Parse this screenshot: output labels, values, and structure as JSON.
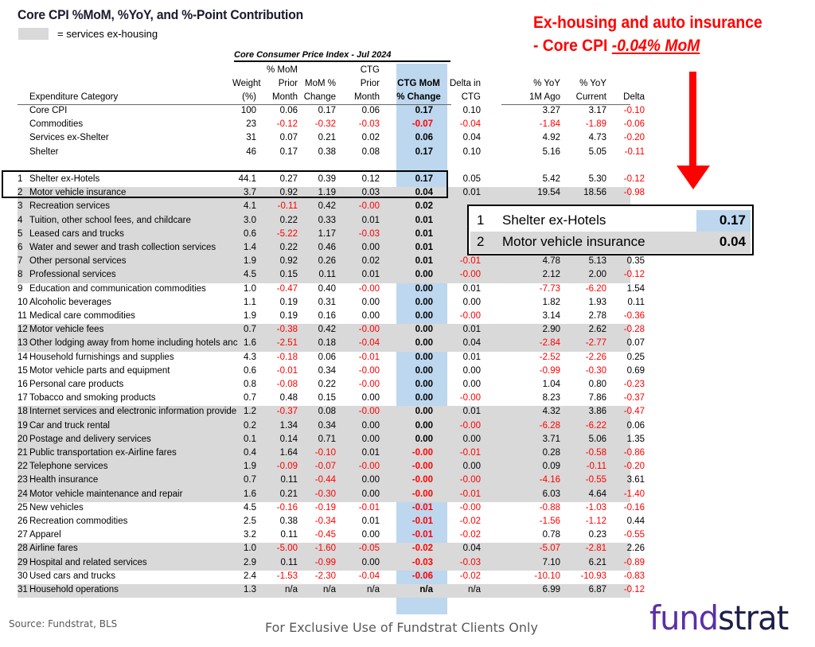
{
  "title": "Core CPI %MoM, %YoY, and %-Point Contribution",
  "legend": {
    "label": "= services ex-housing",
    "swatch_color": "#d9d9d9"
  },
  "callout": {
    "line1": "Ex-housing and auto insurance",
    "line2_prefix": "- Core CPI ",
    "line2_value": "-0.04% MoM",
    "color": "#ff0000"
  },
  "table": {
    "caption": "Core Consumer Price Index - Jul 2024",
    "headers": {
      "category": "Expenditure Category",
      "weight": [
        "Weight",
        "(%)"
      ],
      "prior": [
        "% MoM",
        "Prior",
        "Month"
      ],
      "mom": [
        "MoM %",
        "Change"
      ],
      "ctg_prior": [
        "CTG",
        "Prior",
        "Month"
      ],
      "ctg": [
        "CTG MoM",
        "% Change"
      ],
      "delta_ctg": [
        "Delta in",
        "CTG"
      ],
      "yoy_1m": [
        "% YoY",
        "1M Ago"
      ],
      "yoy_cur": [
        "% YoY",
        "Current"
      ],
      "delta": [
        "Delta"
      ]
    },
    "summary_rows": [
      {
        "cat": "Core CPI",
        "w": "100",
        "pm": "0.06",
        "mom": "0.17",
        "cp": "0.06",
        "ctg": "0.17",
        "dc": "0.10",
        "y1": "3.27",
        "yc": "3.17",
        "d": "-0.10"
      },
      {
        "cat": "Commodities",
        "w": "23",
        "pm": "-0.12",
        "mom": "-0.32",
        "cp": "-0.03",
        "ctg": "-0.07",
        "dc": "-0.04",
        "y1": "-1.84",
        "yc": "-1.89",
        "d": "-0.06"
      },
      {
        "cat": "Services ex-Shelter",
        "w": "31",
        "pm": "0.07",
        "mom": "0.21",
        "cp": "0.02",
        "ctg": "0.06",
        "dc": "0.04",
        "y1": "4.92",
        "yc": "4.73",
        "d": "-0.20"
      },
      {
        "cat": "Shelter",
        "w": "46",
        "pm": "0.17",
        "mom": "0.38",
        "cp": "0.08",
        "ctg": "0.17",
        "dc": "0.10",
        "y1": "5.16",
        "yc": "5.05",
        "d": "-0.11"
      }
    ],
    "rows": [
      {
        "n": "1",
        "cat": "Shelter ex-Hotels",
        "g": false,
        "w": "44.1",
        "pm": "0.27",
        "mom": "0.39",
        "cp": "0.12",
        "ctg": "0.17",
        "dc": "0.05",
        "y1": "5.42",
        "yc": "5.30",
        "d": "-0.12"
      },
      {
        "n": "2",
        "cat": "Motor vehicle insurance",
        "g": true,
        "w": "3.7",
        "pm": "0.92",
        "mom": "1.19",
        "cp": "0.03",
        "ctg": "0.04",
        "dc": "0.01",
        "y1": "19.54",
        "yc": "18.56",
        "d": "-0.98"
      },
      {
        "n": "3",
        "cat": "Recreation services",
        "g": true,
        "w": "4.1",
        "pm": "-0.11",
        "mom": "0.42",
        "cp": "-0.00",
        "ctg": "0.02",
        "dc": "",
        "y1": "",
        "yc": "",
        "d": ""
      },
      {
        "n": "4",
        "cat": "Tuition, other school fees, and childcare",
        "g": true,
        "w": "3.0",
        "pm": "0.22",
        "mom": "0.33",
        "cp": "0.01",
        "ctg": "0.01",
        "dc": "",
        "y1": "",
        "yc": "",
        "d": ""
      },
      {
        "n": "5",
        "cat": "Leased cars and trucks",
        "g": true,
        "w": "0.6",
        "pm": "-5.22",
        "mom": "1.17",
        "cp": "-0.03",
        "ctg": "0.01",
        "dc": "",
        "y1": "",
        "yc": "",
        "d": ""
      },
      {
        "n": "6",
        "cat": "Water and sewer and trash collection services",
        "g": true,
        "w": "1.4",
        "pm": "0.22",
        "mom": "0.46",
        "cp": "0.00",
        "ctg": "0.01",
        "dc": "",
        "y1": "",
        "yc": "",
        "d": ""
      },
      {
        "n": "7",
        "cat": "Other personal services",
        "g": true,
        "w": "1.9",
        "pm": "0.92",
        "mom": "0.26",
        "cp": "0.02",
        "ctg": "0.01",
        "dc": "-0.01",
        "y1": "4.78",
        "yc": "5.13",
        "d": "0.35"
      },
      {
        "n": "8",
        "cat": "Professional services",
        "g": true,
        "w": "4.5",
        "pm": "0.15",
        "mom": "0.11",
        "cp": "0.01",
        "ctg": "0.00",
        "dc": "-0.00",
        "y1": "2.12",
        "yc": "2.00",
        "d": "-0.12"
      },
      {
        "n": "9",
        "cat": "Education and communication commodities",
        "g": false,
        "w": "1.0",
        "pm": "-0.47",
        "mom": "0.40",
        "cp": "-0.00",
        "ctg": "0.00",
        "dc": "0.01",
        "y1": "-7.73",
        "yc": "-6.20",
        "d": "1.54"
      },
      {
        "n": "10",
        "cat": "Alcoholic beverages",
        "g": false,
        "w": "1.1",
        "pm": "0.19",
        "mom": "0.31",
        "cp": "0.00",
        "ctg": "0.00",
        "dc": "0.00",
        "y1": "1.82",
        "yc": "1.93",
        "d": "0.11"
      },
      {
        "n": "11",
        "cat": "Medical care commodities",
        "g": false,
        "w": "1.9",
        "pm": "0.19",
        "mom": "0.16",
        "cp": "0.00",
        "ctg": "0.00",
        "dc": "-0.00",
        "y1": "3.14",
        "yc": "2.78",
        "d": "-0.36"
      },
      {
        "n": "12",
        "cat": "Motor vehicle fees",
        "g": true,
        "w": "0.7",
        "pm": "-0.38",
        "mom": "0.42",
        "cp": "-0.00",
        "ctg": "0.00",
        "dc": "0.01",
        "y1": "2.90",
        "yc": "2.62",
        "d": "-0.28"
      },
      {
        "n": "13",
        "cat": "Other lodging away from home including hotels anc",
        "g": true,
        "w": "1.6",
        "pm": "-2.51",
        "mom": "0.18",
        "cp": "-0.04",
        "ctg": "0.00",
        "dc": "0.04",
        "y1": "-2.84",
        "yc": "-2.77",
        "d": "0.07"
      },
      {
        "n": "14",
        "cat": "Household furnishings and supplies",
        "g": false,
        "w": "4.3",
        "pm": "-0.18",
        "mom": "0.06",
        "cp": "-0.01",
        "ctg": "0.00",
        "dc": "0.01",
        "y1": "-2.52",
        "yc": "-2.26",
        "d": "0.25"
      },
      {
        "n": "15",
        "cat": "Motor vehicle parts and equipment",
        "g": false,
        "w": "0.6",
        "pm": "-0.01",
        "mom": "0.34",
        "cp": "-0.00",
        "ctg": "0.00",
        "dc": "0.00",
        "y1": "-0.99",
        "yc": "-0.30",
        "d": "0.69"
      },
      {
        "n": "16",
        "cat": "Personal care products",
        "g": false,
        "w": "0.8",
        "pm": "-0.08",
        "mom": "0.22",
        "cp": "-0.00",
        "ctg": "0.00",
        "dc": "0.00",
        "y1": "1.04",
        "yc": "0.80",
        "d": "-0.23"
      },
      {
        "n": "17",
        "cat": "Tobacco and smoking products",
        "g": false,
        "w": "0.7",
        "pm": "0.48",
        "mom": "0.15",
        "cp": "0.00",
        "ctg": "0.00",
        "dc": "-0.00",
        "y1": "8.23",
        "yc": "7.86",
        "d": "-0.37"
      },
      {
        "n": "18",
        "cat": "Internet services and electronic information provide",
        "g": true,
        "w": "1.2",
        "pm": "-0.37",
        "mom": "0.08",
        "cp": "-0.00",
        "ctg": "0.00",
        "dc": "0.01",
        "y1": "4.32",
        "yc": "3.86",
        "d": "-0.47"
      },
      {
        "n": "19",
        "cat": "Car and truck rental",
        "g": true,
        "w": "0.2",
        "pm": "1.34",
        "mom": "0.34",
        "cp": "0.00",
        "ctg": "0.00",
        "dc": "-0.00",
        "y1": "-6.28",
        "yc": "-6.22",
        "d": "0.06"
      },
      {
        "n": "20",
        "cat": "Postage and delivery services",
        "g": true,
        "w": "0.1",
        "pm": "0.14",
        "mom": "0.71",
        "cp": "0.00",
        "ctg": "0.00",
        "dc": "0.00",
        "y1": "3.71",
        "yc": "5.06",
        "d": "1.35"
      },
      {
        "n": "21",
        "cat": "Public transportation ex-Airline fares",
        "g": true,
        "w": "0.4",
        "pm": "1.64",
        "mom": "-0.10",
        "cp": "0.01",
        "ctg": "-0.00",
        "dc": "-0.01",
        "y1": "0.28",
        "yc": "-0.58",
        "d": "-0.86"
      },
      {
        "n": "22",
        "cat": "Telephone services",
        "g": true,
        "w": "1.9",
        "pm": "-0.09",
        "mom": "-0.07",
        "cp": "-0.00",
        "ctg": "-0.00",
        "dc": "0.00",
        "y1": "0.09",
        "yc": "-0.11",
        "d": "-0.20"
      },
      {
        "n": "23",
        "cat": "Health insurance",
        "g": true,
        "w": "0.7",
        "pm": "0.11",
        "mom": "-0.44",
        "cp": "0.00",
        "ctg": "-0.00",
        "dc": "-0.00",
        "y1": "-4.16",
        "yc": "-0.55",
        "d": "3.61"
      },
      {
        "n": "24",
        "cat": "Motor vehicle maintenance and repair",
        "g": true,
        "w": "1.6",
        "pm": "0.21",
        "mom": "-0.30",
        "cp": "0.00",
        "ctg": "-0.00",
        "dc": "-0.01",
        "y1": "6.03",
        "yc": "4.64",
        "d": "-1.40"
      },
      {
        "n": "25",
        "cat": "New vehicles",
        "g": false,
        "w": "4.5",
        "pm": "-0.16",
        "mom": "-0.19",
        "cp": "-0.01",
        "ctg": "-0.01",
        "dc": "-0.00",
        "y1": "-0.88",
        "yc": "-1.03",
        "d": "-0.16"
      },
      {
        "n": "26",
        "cat": "Recreation commodities",
        "g": false,
        "w": "2.5",
        "pm": "0.38",
        "mom": "-0.34",
        "cp": "0.01",
        "ctg": "-0.01",
        "dc": "-0.02",
        "y1": "-1.56",
        "yc": "-1.12",
        "d": "0.44"
      },
      {
        "n": "27",
        "cat": "Apparel",
        "g": false,
        "w": "3.2",
        "pm": "0.11",
        "mom": "-0.45",
        "cp": "0.00",
        "ctg": "-0.01",
        "dc": "-0.02",
        "y1": "0.78",
        "yc": "0.23",
        "d": "-0.55"
      },
      {
        "n": "28",
        "cat": "Airline fares",
        "g": true,
        "w": "1.0",
        "pm": "-5.00",
        "mom": "-1.60",
        "cp": "-0.05",
        "ctg": "-0.02",
        "dc": "0.04",
        "y1": "-5.07",
        "yc": "-2.81",
        "d": "2.26"
      },
      {
        "n": "29",
        "cat": "Hospital and related services",
        "g": true,
        "w": "2.9",
        "pm": "0.11",
        "mom": "-0.99",
        "cp": "0.00",
        "ctg": "-0.03",
        "dc": "-0.03",
        "y1": "7.10",
        "yc": "6.21",
        "d": "-0.89"
      },
      {
        "n": "30",
        "cat": "Used cars and trucks",
        "g": false,
        "w": "2.4",
        "pm": "-1.53",
        "mom": "-2.30",
        "cp": "-0.04",
        "ctg": "-0.06",
        "dc": "-0.02",
        "y1": "-10.10",
        "yc": "-10.93",
        "d": "-0.83"
      },
      {
        "n": "31",
        "cat": "Household operations",
        "g": true,
        "w": "1.3",
        "pm": "n/a",
        "mom": "n/a",
        "cp": "n/a",
        "ctg": "n/a",
        "dc": "n/a",
        "y1": "6.99",
        "yc": "6.87",
        "d": "-0.12"
      }
    ]
  },
  "inset": {
    "rows": [
      {
        "n": "1",
        "label": "Shelter ex-Hotels",
        "value": "0.17"
      },
      {
        "n": "2",
        "label": "Motor vehicle insurance",
        "value": "0.04"
      }
    ]
  },
  "footer": {
    "source": "Source: Fundstrat, BLS",
    "exclusive": "For Exclusive Use of Fundstrat Clients Only",
    "logo_part1": "fund",
    "logo_part2": "strat"
  },
  "colors": {
    "negative": "#ff0000",
    "ctg_band": "#bdd7ee",
    "services_gray": "#d9d9d9",
    "logo_purple": "#5b2fa8",
    "logo_navy": "#1c1f4a"
  }
}
